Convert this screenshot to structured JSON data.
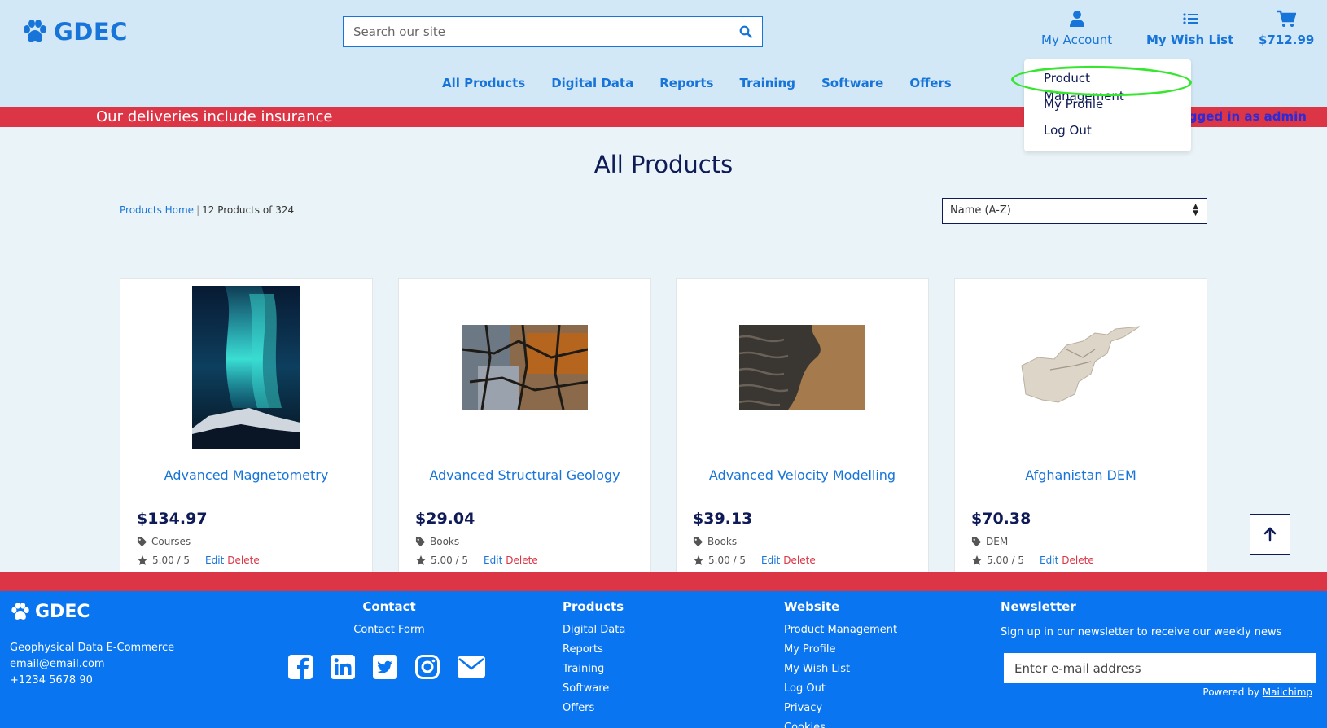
{
  "brand": {
    "name": "GDEC"
  },
  "search": {
    "placeholder": "Search our site"
  },
  "header_links": {
    "account": "My Account",
    "wishlist": "My Wish List",
    "cart_total": "$712.99"
  },
  "nav": [
    "All Products",
    "Digital Data",
    "Reports",
    "Training",
    "Software",
    "Offers"
  ],
  "notice": {
    "message": "Our deliveries include insurance",
    "login_status": "Logged in as admin"
  },
  "account_menu": [
    "Product Management",
    "My Profile",
    "Log Out"
  ],
  "main": {
    "title": "All Products",
    "breadcrumb_home": "Products Home",
    "breadcrumb_separator": "|",
    "count": "12 Products of 324",
    "sort_value": "Name (A-Z)"
  },
  "products": [
    {
      "name": "Advanced Magnetometry",
      "price": "$134.97",
      "category": "Courses",
      "rating": "5.00 / 5",
      "edit": "Edit",
      "delete": "Delete",
      "image": "aurora-image"
    },
    {
      "name": "Advanced Structural Geology",
      "price": "$29.04",
      "category": "Books",
      "rating": "5.00 / 5",
      "edit": "Edit",
      "delete": "Delete",
      "image": "cracked-rock-image"
    },
    {
      "name": "Advanced Velocity Modelling",
      "price": "$39.13",
      "category": "Books",
      "rating": "5.00 / 5",
      "edit": "Edit",
      "delete": "Delete",
      "image": "terrain-image"
    },
    {
      "name": "Afghanistan DEM",
      "price": "$70.38",
      "category": "DEM",
      "rating": "5.00 / 5",
      "edit": "Edit",
      "delete": "Delete",
      "image": "dem-map-image"
    }
  ],
  "footer": {
    "brand": "GDEC",
    "about": [
      "Geophysical Data E-Commerce",
      "email@email.com",
      "+1234 5678 90"
    ],
    "contact": {
      "heading": "Contact",
      "link": "Contact Form"
    },
    "products": {
      "heading": "Products",
      "links": [
        "Digital Data",
        "Reports",
        "Training",
        "Software",
        "Offers"
      ]
    },
    "website": {
      "heading": "Website",
      "links": [
        "Product Management",
        "My Profile",
        "My Wish List",
        "Log Out",
        "Privacy",
        "Cookies"
      ]
    },
    "newsletter": {
      "heading": "Newsletter",
      "text": "Sign up in our newsletter to receive our weekly news",
      "placeholder": "Enter e-mail address",
      "powered_prefix": "Powered by",
      "powered_link": "Mailchimp"
    }
  },
  "colors": {
    "brand_blue": "#1774d9",
    "header_bg": "#d3e8f6",
    "red": "#dc3545",
    "footer_blue": "#0a75f0",
    "navy": "#0f1b57",
    "highlight_green": "#37e62e"
  }
}
